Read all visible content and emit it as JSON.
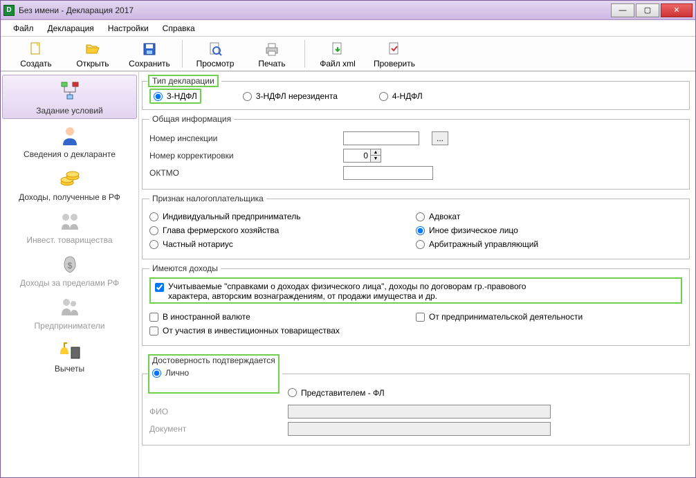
{
  "title": "Без имени - Декларация 2017",
  "menubar": {
    "file": "Файл",
    "decl": "Декларация",
    "settings": "Настройки",
    "help": "Справка"
  },
  "toolbar": {
    "create": "Создать",
    "open": "Открыть",
    "save": "Сохранить",
    "preview": "Просмотр",
    "print": "Печать",
    "xml": "Файл xml",
    "check": "Проверить"
  },
  "sidebar": {
    "conditions": "Задание условий",
    "declarant": "Сведения о декларанте",
    "income_rf": "Доходы, полученные в РФ",
    "invest": "Инвест. товарищества",
    "income_abroad": "Доходы за пределами РФ",
    "entrepreneurs": "Предприниматели",
    "deductions": "Вычеты"
  },
  "decl_type": {
    "legend": "Тип декларации",
    "ndfl3": "3-НДФЛ",
    "ndfl3_nonres": "3-НДФЛ нерезидента",
    "ndfl4": "4-НДФЛ"
  },
  "general": {
    "legend": "Общая информация",
    "inspection": "Номер инспекции",
    "inspection_btn": "...",
    "correction": "Номер корректировки",
    "correction_val": "0",
    "oktmo": "ОКТМО"
  },
  "taxpayer": {
    "legend": "Признак налогоплательщика",
    "ip": "Индивидуальный предприниматель",
    "advocate": "Адвокат",
    "farmer": "Глава фермерского хозяйства",
    "other_person": "Иное физическое лицо",
    "notary": "Частный нотариус",
    "arbitr": "Арбитражный управляющий"
  },
  "income": {
    "legend": "Имеются доходы",
    "spravki": "Учитываемые \"справками о доходах физического лица\", доходы по договорам гр.-правового характера, авторским вознаграждениям, от продажи имущества и др.",
    "foreign": "В иностранной валюте",
    "business": "От предпринимательской деятельности",
    "invest": "От участия в инвестиционных товариществах"
  },
  "trust": {
    "legend": "Достоверность подтверждается",
    "self": "Лично",
    "repr": "Представителем - ФЛ",
    "fio": "ФИО",
    "doc": "Документ"
  }
}
